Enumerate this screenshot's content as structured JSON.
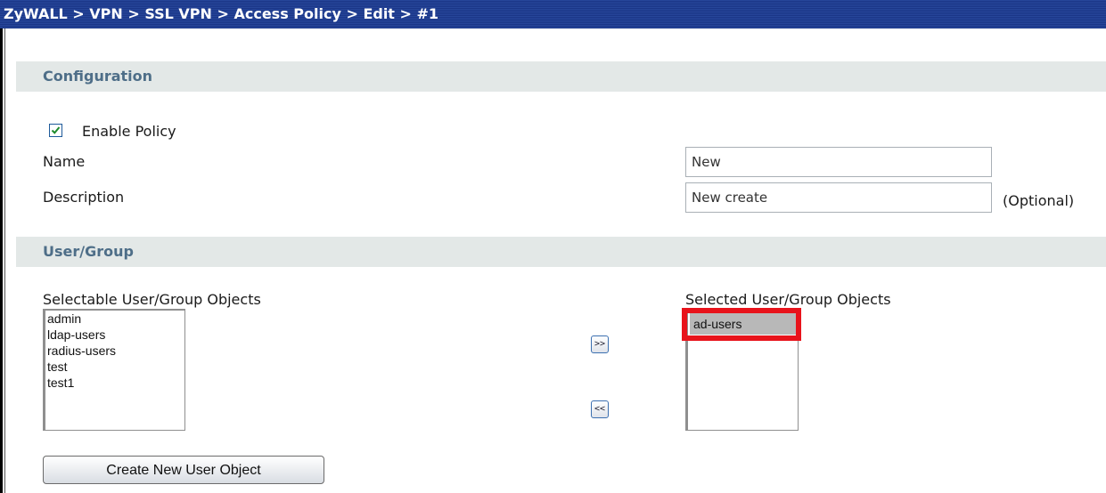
{
  "breadcrumb": "ZyWALL > VPN > SSL VPN > Access Policy > Edit > #1",
  "sections": {
    "configuration": "Configuration",
    "user_group": "User/Group"
  },
  "config": {
    "enable_policy_label": "Enable Policy",
    "enable_policy_checked": true,
    "name_label": "Name",
    "name_value": "New",
    "description_label": "Description",
    "description_value": "New create",
    "optional_hint": "(Optional)"
  },
  "user_group": {
    "selectable_label": "Selectable User/Group Objects",
    "selectable_items": [
      "admin",
      "ldap-users",
      "radius-users",
      "test",
      "test1"
    ],
    "selected_label": "Selected User/Group Objects",
    "selected_items": [
      "ad-users"
    ],
    "add_button": ">>",
    "remove_button": "<<",
    "create_button": "Create New User Object"
  },
  "colors": {
    "title_bar": "#1b3a8c",
    "section_header_bg": "#e3e8e7",
    "section_header_text": "#4e6e88",
    "highlight_box": "#e8131b",
    "selected_item_bg": "#b8b8b8"
  }
}
